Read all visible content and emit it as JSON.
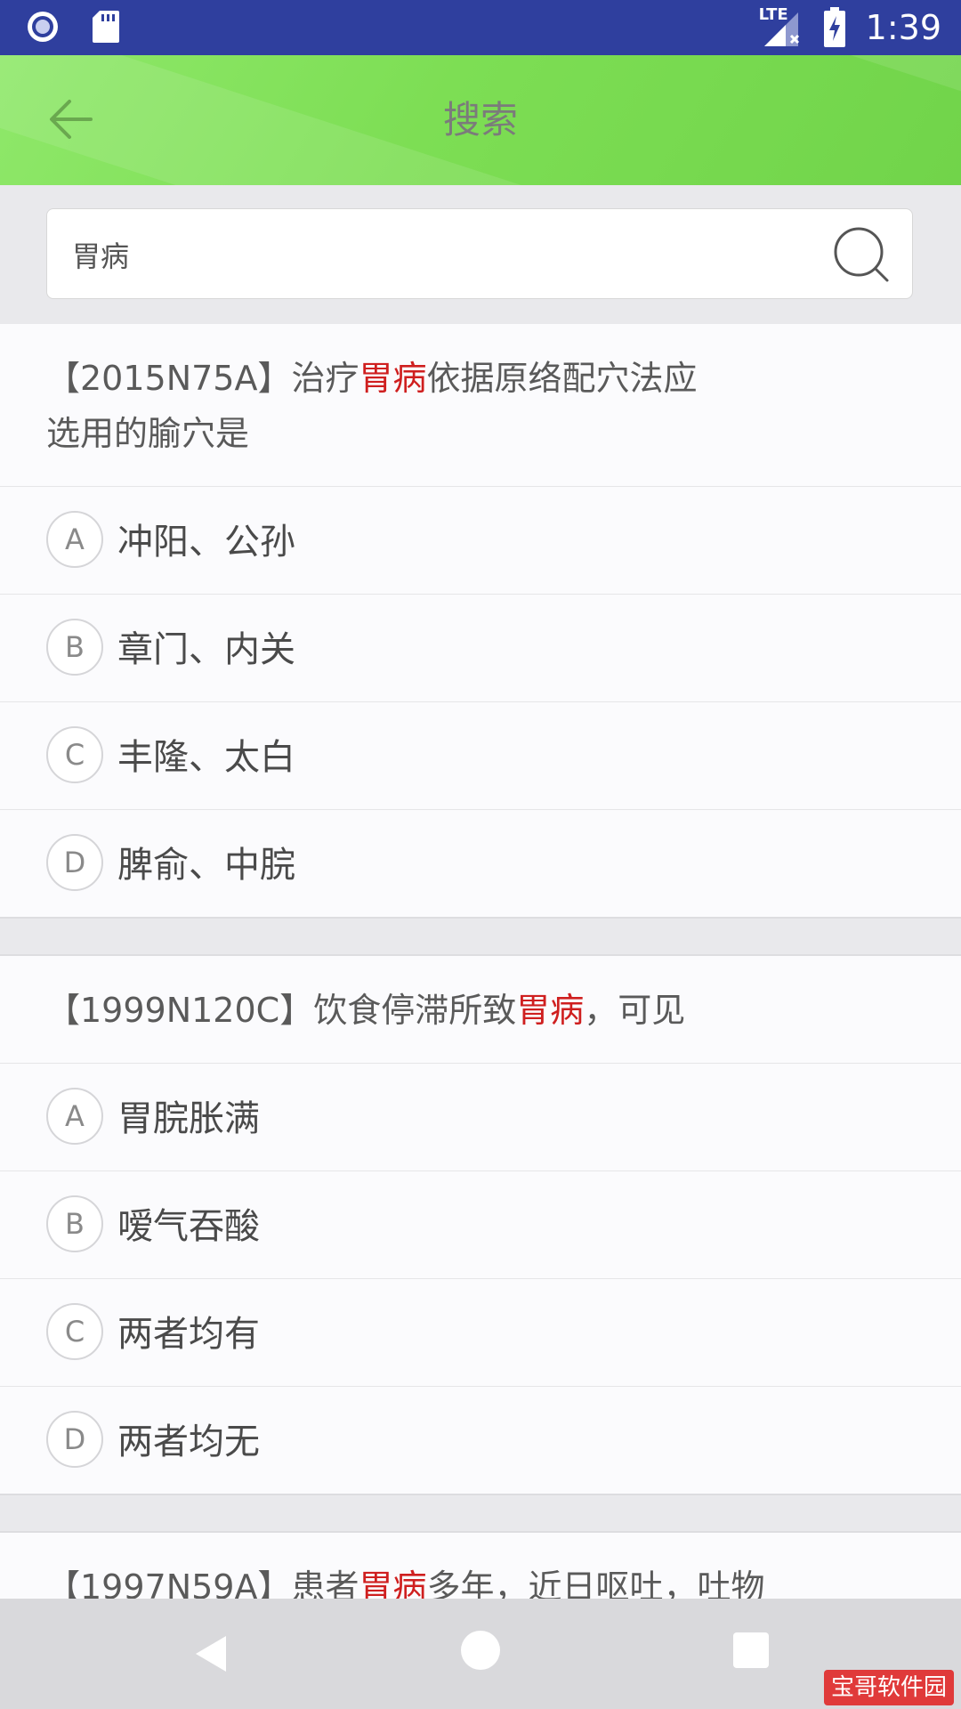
{
  "status_bar": {
    "time": "1:39",
    "network_label": "LTE",
    "icons": [
      "record-icon",
      "sd-card-icon",
      "signal-icon",
      "battery-charging-icon"
    ]
  },
  "header": {
    "title": "搜索",
    "back_icon": "arrow-left-icon"
  },
  "search": {
    "value": "胃病",
    "placeholder": "",
    "icon": "search-icon"
  },
  "questions": [
    {
      "stem_lines": [
        [
          {
            "text": "【2015N75A】治疗",
            "hl": false
          },
          {
            "text": "胃病",
            "hl": true
          },
          {
            "text": "依据原络配穴法应",
            "hl": false
          }
        ],
        [
          {
            "text": "选用的腧穴是",
            "hl": false
          }
        ]
      ],
      "options": [
        {
          "letter": "A",
          "text": "冲阳、公孙"
        },
        {
          "letter": "B",
          "text": "章门、内关"
        },
        {
          "letter": "C",
          "text": "丰隆、太白"
        },
        {
          "letter": "D",
          "text": "脾俞、中脘"
        }
      ]
    },
    {
      "stem_lines": [
        [
          {
            "text": "【1999N120C】饮食停滞所致",
            "hl": false
          },
          {
            "text": "胃病",
            "hl": true
          },
          {
            "text": "，可见",
            "hl": false
          }
        ]
      ],
      "options": [
        {
          "letter": "A",
          "text": "胃脘胀满"
        },
        {
          "letter": "B",
          "text": "嗳气吞酸"
        },
        {
          "letter": "C",
          "text": "两者均有"
        },
        {
          "letter": "D",
          "text": "两者均无"
        }
      ]
    },
    {
      "stem_lines": [
        [
          {
            "text": "【1997N59A】患者",
            "hl": false
          },
          {
            "text": "胃病",
            "hl": true
          },
          {
            "text": "多年，近日呕吐，吐物",
            "hl": false
          }
        ]
      ],
      "options": []
    }
  ],
  "nav_bar": {
    "icons": [
      "nav-back-icon",
      "nav-home-icon",
      "nav-recent-icon"
    ]
  },
  "watermark": "宝哥软件园",
  "colors": {
    "status_bar": "#2f3f9e",
    "header_green": "#7dde54",
    "highlight": "#cf1f1f"
  }
}
